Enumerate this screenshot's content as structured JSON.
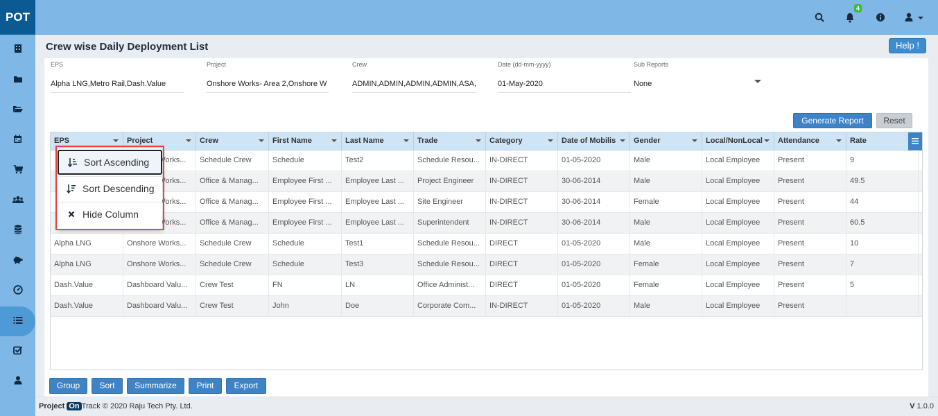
{
  "app": {
    "logo": "POT"
  },
  "topbar": {
    "notification_count": "4",
    "icons": [
      "search-icon",
      "bell-icon",
      "info-icon",
      "user-icon",
      "caret-down-icon"
    ]
  },
  "sidebar": {
    "items": [
      {
        "icon": "building-icon"
      },
      {
        "icon": "folder-icon"
      },
      {
        "icon": "folder-open-icon"
      },
      {
        "icon": "calendar-icon"
      },
      {
        "icon": "cart-icon"
      },
      {
        "icon": "users-icon"
      },
      {
        "icon": "database-icon"
      },
      {
        "icon": "piggy-bank-icon"
      },
      {
        "icon": "dashboard-icon"
      },
      {
        "icon": "list-icon",
        "active": true
      },
      {
        "icon": "checklist-icon"
      },
      {
        "icon": "user-icon"
      }
    ]
  },
  "page": {
    "title": "Crew wise Daily Deployment List",
    "help_label": "Help !"
  },
  "filters": {
    "eps": {
      "label": "EPS",
      "value": "Alpha LNG,Metro Rail,Dash.Value"
    },
    "project": {
      "label": "Project",
      "value": "Onshore  Works- Area 2,Onshore  W"
    },
    "crew": {
      "label": "Crew",
      "value": "ADMIN,ADMIN,ADMIN,ADMIN,ASA,"
    },
    "date": {
      "label": "Date (dd-mm-yyyy)",
      "value": "01-May-2020"
    },
    "sub_reports": {
      "label": "Sub Reports",
      "value": "None"
    }
  },
  "actions": {
    "generate": "Generate Report",
    "reset": "Reset"
  },
  "grid": {
    "columns": [
      "EPS",
      "Project",
      "Crew",
      "First Name",
      "Last Name",
      "Trade",
      "Category",
      "Date of Mobilis",
      "Gender",
      "Local/NonLocal",
      "Attendance",
      "Rate"
    ],
    "rows": [
      [
        "",
        "Onshore Works...",
        "Schedule Crew",
        "Schedule",
        "Test2",
        "Schedule Resou...",
        "IN-DIRECT",
        "01-05-2020",
        "Male",
        "Local Employee",
        "Present",
        "9"
      ],
      [
        "",
        "Onshore Works...",
        "Office & Manag...",
        "Employee First ...",
        "Employee Last ...",
        "Project Engineer",
        "IN-DIRECT",
        "30-06-2014",
        "Male",
        "Local Employee",
        "Present",
        "49.5"
      ],
      [
        "",
        "Onshore Works...",
        "Office & Manag...",
        "Employee First ...",
        "Employee Last ...",
        "Site Engineer",
        "IN-DIRECT",
        "30-06-2014",
        "Female",
        "Local Employee",
        "Present",
        "44"
      ],
      [
        "",
        "Onshore Works...",
        "Office & Manag...",
        "Employee First ...",
        "Employee Last ...",
        "Superintendent",
        "IN-DIRECT",
        "30-06-2014",
        "Male",
        "Local Employee",
        "Present",
        "60.5"
      ],
      [
        "Alpha LNG",
        "Onshore Works...",
        "Schedule Crew",
        "Schedule",
        "Test1",
        "Schedule Resou...",
        "DIRECT",
        "01-05-2020",
        "Male",
        "Local Employee",
        "Present",
        "10"
      ],
      [
        "Alpha LNG",
        "Onshore Works...",
        "Schedule Crew",
        "Schedule",
        "Test3",
        "Schedule Resou...",
        "DIRECT",
        "01-05-2020",
        "Female",
        "Local Employee",
        "Present",
        "7"
      ],
      [
        "Dash.Value",
        "Dashboard Valu...",
        "Crew Test",
        "FN",
        "LN",
        "Office Administ...",
        "DIRECT",
        "01-05-2020",
        "Female",
        "Local Employee",
        "Present",
        "5"
      ],
      [
        "Dash.Value",
        "Dashboard Valu...",
        "Crew Test",
        "John",
        "Doe",
        "Corporate Com...",
        "IN-DIRECT",
        "01-05-2020",
        "Male",
        "Local Employee",
        "Present",
        ""
      ]
    ]
  },
  "column_menu": {
    "sort_asc": "Sort Ascending",
    "sort_desc": "Sort Descending",
    "hide": "Hide Column"
  },
  "bottom_buttons": [
    "Group",
    "Sort",
    "Summarize",
    "Print",
    "Export"
  ],
  "footer": {
    "brand_a": "Project ",
    "brand_on": "On",
    "brand_b": "Track",
    "copyright": " © 2020 Raju Tech Pty. Ltd.",
    "version_label": "V",
    "version": " 1.0.0"
  }
}
